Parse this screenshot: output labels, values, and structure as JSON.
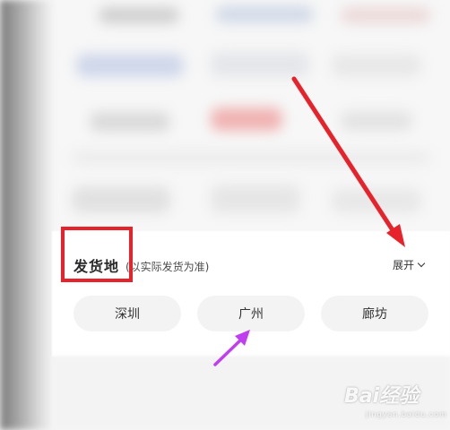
{
  "shipping_origin": {
    "title": "发货地",
    "note": "(以实际发货为准)",
    "expand_label": "展开",
    "options": [
      {
        "label": "深圳"
      },
      {
        "label": "广州"
      },
      {
        "label": "廊坊"
      }
    ]
  },
  "watermark": {
    "logo_text": "Bai经验",
    "sub_text": "jingyan.baidu.com"
  },
  "colors": {
    "annotation_red": "#e8222a",
    "annotation_magenta": "#c13df0",
    "chip_background": "#f3f3f3",
    "sheet_background": "#ffffff"
  }
}
